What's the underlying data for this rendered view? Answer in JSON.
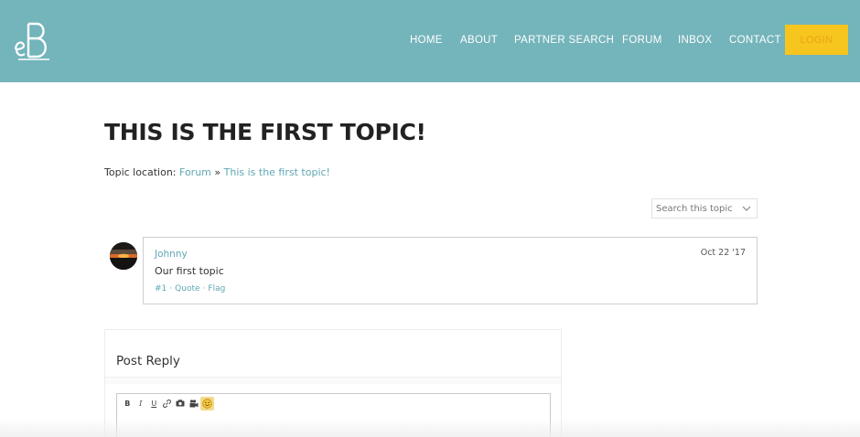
{
  "header": {
    "logo_text": "eB",
    "nav": {
      "home": "HOME",
      "about": "ABOUT",
      "partner_search": "PARTNER SEARCH",
      "forum": "FORUM",
      "inbox": "INBOX",
      "contact": "CONTACT"
    },
    "login_label": "LOGIN",
    "colors": {
      "bar": "#74b4bb",
      "login": "#f6c51e"
    }
  },
  "topic": {
    "title": "THIS IS THE FIRST TOPIC!",
    "location_label": "Topic location:",
    "crumb_forum": "Forum",
    "crumb_sep": "»",
    "crumb_topic": "This is the first topic!"
  },
  "search": {
    "placeholder": "Search this topic"
  },
  "post": {
    "author": "Johnny",
    "date": "Oct 22 '17",
    "body": "Our first topic",
    "number": "#1",
    "quote": "Quote",
    "flag": "Flag",
    "sep": "·"
  },
  "reply": {
    "title": "Post Reply",
    "toolbar": [
      "bold-icon",
      "italic-icon",
      "underline-icon",
      "link-icon",
      "camera-icon",
      "video-icon",
      "emoji-icon"
    ],
    "bold": "B",
    "italic": "I",
    "underline": "U"
  }
}
